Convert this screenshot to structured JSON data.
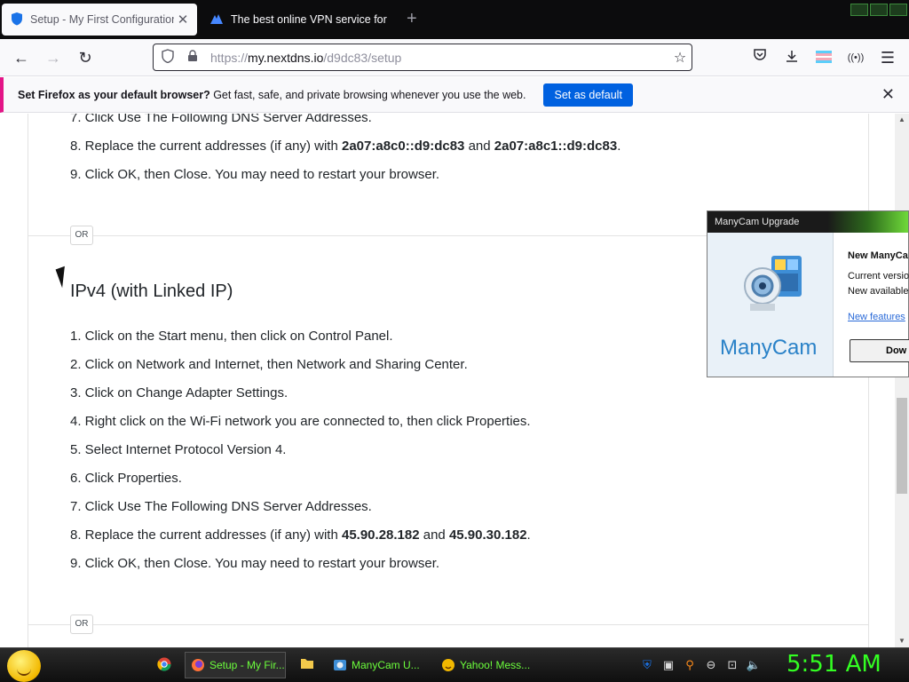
{
  "browser": {
    "tabs": [
      {
        "title": "Setup - My First Configuration",
        "active": true,
        "icon": "shield-icon"
      },
      {
        "title": "The best online VPN service for",
        "active": false,
        "icon": "vpn-icon"
      }
    ],
    "new_tab": "+",
    "url_prefix": "https://",
    "url_domain": "my.nextdns.io",
    "url_path": "/d9dc83/setup"
  },
  "notification": {
    "bold": "Set Firefox as your default browser?",
    "text": " Get fast, safe, and private browsing whenever you use the web.",
    "button": "Set as default"
  },
  "content": {
    "top_steps": [
      {
        "text": "7. Click Use The Following DNS Server Addresses."
      },
      {
        "pre": "8. Replace the current addresses (if any) with ",
        "a": "2a07:a8c0::d9:dc83",
        "mid": " and ",
        "b": "2a07:a8c1::d9:dc83",
        "post": "."
      },
      {
        "text": "9. Click OK, then Close. You may need to restart your browser."
      }
    ],
    "or_label": "OR",
    "heading": "IPv4 (with Linked IP)",
    "steps": [
      "1. Click on the Start menu, then click on Control Panel.",
      "2. Click on Network and Internet, then Network and Sharing Center.",
      "3. Click on Change Adapter Settings.",
      "4. Right click on the Wi-Fi network you are connected to, then click Properties.",
      "5. Select Internet Protocol Version 4.",
      "6. Click Properties.",
      "7. Click Use The Following DNS Server Addresses."
    ],
    "step8": {
      "pre": "8. Replace the current addresses (if any) with ",
      "a": "45.90.28.182",
      "mid": " and ",
      "b": "45.90.30.182",
      "post": "."
    },
    "step9": "9. Click OK, then Close. You may need to restart your browser."
  },
  "popup": {
    "title": "ManyCam Upgrade",
    "logo": "ManyCam",
    "heading": "New ManyCa",
    "current": "Current versio",
    "available": "New available",
    "link": "New features",
    "button": "Dow"
  },
  "taskbar": {
    "items": [
      {
        "label": "Setup - My Fir...",
        "active": true
      },
      {
        "label": "ManyCam U...",
        "active": false
      },
      {
        "label": "Yahoo! Mess...",
        "active": false
      }
    ],
    "clock": "5:51 AM"
  },
  "colors": {
    "accent": "#0061e0",
    "notif_border": "#e31587",
    "clock": "#33ff22"
  }
}
